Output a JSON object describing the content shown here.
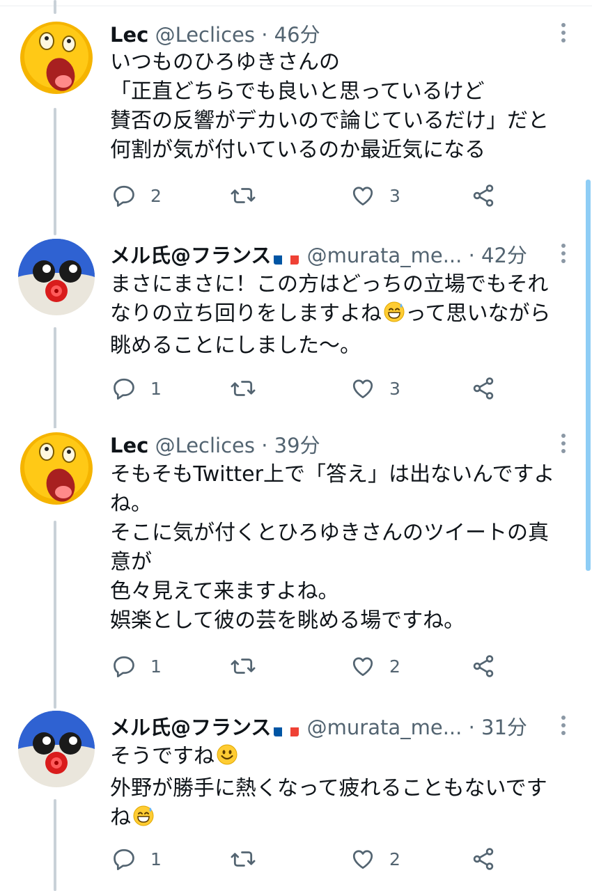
{
  "tweets": [
    {
      "avatar": "yellow-character-avatar",
      "name": "Lec",
      "handle": "@Leclices",
      "separator": "·",
      "time": "46分",
      "has_flag": false,
      "lines": [
        "いつものひろゆきさんの",
        "「正直どちらでも良いと思っているけど",
        "賛否の反響がデカいので論じているだけ」だと",
        "何割が気が付いているのか最近気になる"
      ],
      "reply_count": "2",
      "retweet_count": "",
      "like_count": "3"
    },
    {
      "avatar": "blue-penguin-avatar",
      "name": "メル氏@フランス",
      "handle": "@murata_me...",
      "separator": "·",
      "time": "42分",
      "has_flag": true,
      "lines": [
        "まさにまさに！この方はどっちの立場でもそれ",
        "なりの立ち回りをしますよね",
        "眺めることにしました〜。"
      ],
      "line2_tail": "って思いながら",
      "reply_count": "1",
      "retweet_count": "",
      "like_count": "3"
    },
    {
      "avatar": "yellow-character-avatar",
      "name": "Lec",
      "handle": "@Leclices",
      "separator": "·",
      "time": "39分",
      "has_flag": false,
      "lines": [
        "そもそもTwitter上で「答え」は出ないんですよ",
        "ね。",
        "そこに気が付くとひろゆきさんのツイートの真",
        "意が",
        "色々見えて来ますよね。",
        "娯楽として彼の芸を眺める場ですね。"
      ],
      "reply_count": "1",
      "retweet_count": "",
      "like_count": "2"
    },
    {
      "avatar": "blue-penguin-avatar",
      "name": "メル氏@フランス",
      "handle": "@murata_me...",
      "separator": "·",
      "time": "31分",
      "has_flag": true,
      "lines": [
        "そうですね",
        "外野が勝手に熱くなって疲れることもないです",
        "ね"
      ],
      "reply_count": "1",
      "retweet_count": "",
      "like_count": "2"
    }
  ],
  "colors": {
    "text": "#0f1419",
    "secondary": "#536471",
    "icon": "#536471",
    "thread_line": "#c9d1d8",
    "scrollbar": "#8ecdf5",
    "flag_blue": "#0055a4",
    "flag_red": "#ef4135"
  },
  "icons": {
    "reply": "reply-icon",
    "retweet": "retweet-icon",
    "like": "heart-icon",
    "share": "share-icon",
    "more": "more-vertical-icon",
    "emoji_sweat": "grinning-sweat-emoji",
    "emoji_smile": "smiling-face-emoji"
  }
}
